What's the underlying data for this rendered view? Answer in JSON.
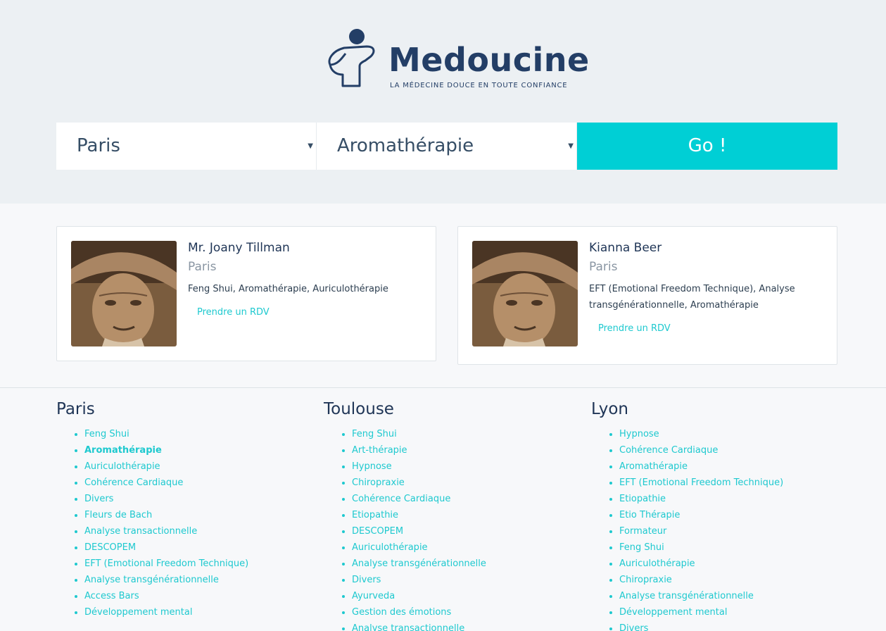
{
  "brand": {
    "name": "Medoucine",
    "tagline": "La médecine douce en toute confiance",
    "color": "#233e66"
  },
  "search": {
    "city": "Paris",
    "specialty": "Aromathérapie",
    "go_label": "Go !",
    "accent": "#00cfd5"
  },
  "practitioners": [
    {
      "name": "Mr. Joany Tillman",
      "city": "Paris",
      "specialties": "Feng Shui, Aromathérapie, Auriculothérapie",
      "cta": "Prendre un RDV"
    },
    {
      "name": "Kianna Beer",
      "city": "Paris",
      "specialties": "EFT (Emotional Freedom Technique), Analyse transgénérationnelle, Aromathérapie",
      "cta": "Prendre un RDV"
    }
  ],
  "directory": [
    {
      "city": "Paris",
      "items": [
        "Feng Shui",
        "Aromathérapie",
        "Auriculothérapie",
        "Cohérence Cardiaque",
        "Divers",
        "Fleurs de Bach",
        "Analyse transactionnelle",
        "DESCOPEM",
        "EFT (Emotional Freedom Technique)",
        "Analyse transgénérationnelle",
        "Access Bars",
        "Développement mental"
      ],
      "active": "Aromathérapie"
    },
    {
      "city": "Toulouse",
      "items": [
        "Feng Shui",
        "Art-thérapie",
        "Hypnose",
        "Chiropraxie",
        "Cohérence Cardiaque",
        "Etiopathie",
        "DESCOPEM",
        "Auriculothérapie",
        "Analyse transgénérationnelle",
        "Divers",
        "Ayurveda",
        "Gestion des émotions",
        "Analyse transactionnelle"
      ]
    },
    {
      "city": "Lyon",
      "items": [
        "Hypnose",
        "Cohérence Cardiaque",
        "Aromathérapie",
        "EFT (Emotional Freedom Technique)",
        "Etiopathie",
        "Etio Thérapie",
        "Formateur",
        "Feng Shui",
        "Auriculothérapie",
        "Chiropraxie",
        "Analyse transgénérationnelle",
        "Développement mental",
        "Divers"
      ]
    }
  ]
}
